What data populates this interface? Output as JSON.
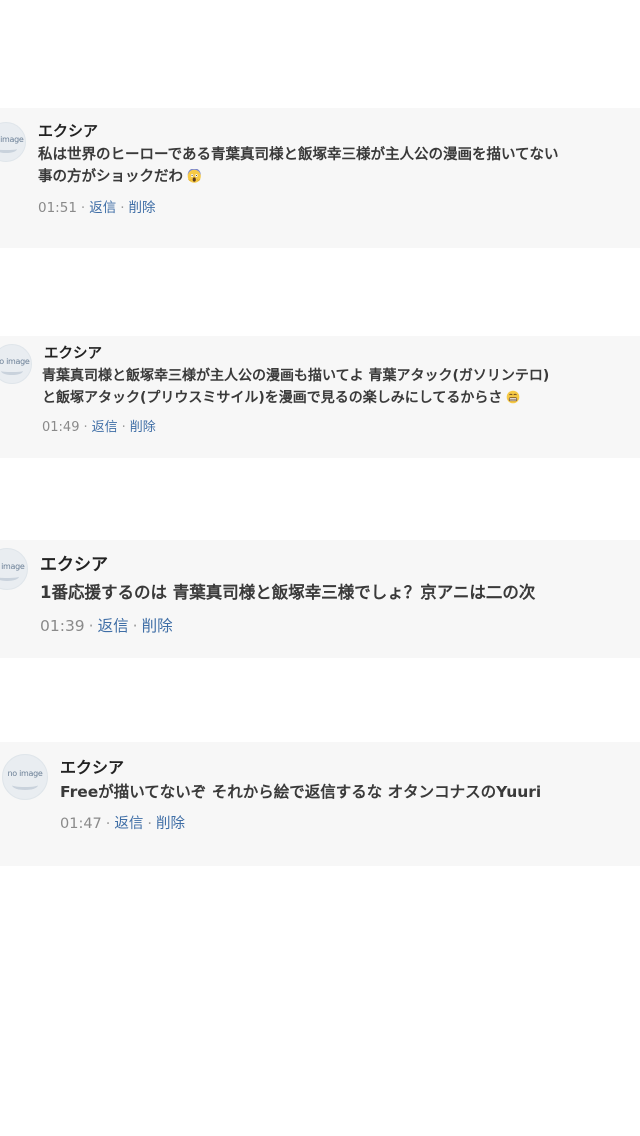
{
  "comments": [
    {
      "avatar_text": "no image",
      "name": "エクシア",
      "lines": [
        "私は世界のヒーローである青葉真司様と飯塚幸三様が主人公の漫画を描いてない",
        "事の方がショックだわ"
      ],
      "emoji": "face-screaming-in-fear-icon",
      "time": "01:51",
      "reply_label": "返信",
      "delete_label": "削除"
    },
    {
      "avatar_text": "no image",
      "name": "エクシア",
      "lines": [
        "青葉真司様と飯塚幸三様が主人公の漫画も描いてよ 青葉アタック(ガソリンテロ)",
        "と飯塚アタック(プリウスミサイル)を漫画で見るの楽しみにしてるからさ"
      ],
      "emoji": "grimacing-face-icon",
      "time": "01:49",
      "reply_label": "返信",
      "delete_label": "削除"
    },
    {
      "avatar_text": "no image",
      "name": "エクシア",
      "lines": [
        "1番応援するのは 青葉真司様と飯塚幸三様でしょ？京アニは二の次"
      ],
      "emoji": "",
      "time": "01:39",
      "reply_label": "返信",
      "delete_label": "削除"
    },
    {
      "avatar_text": "no image",
      "name": "エクシア",
      "lines": [
        "Freeが描いてないぞ それから絵で返信するな オタンコナスのYuuri"
      ],
      "emoji": "",
      "time": "01:47",
      "reply_label": "返信",
      "delete_label": "削除"
    }
  ],
  "colors": {
    "card_bg": "#f7f7f7",
    "link": "#3f6ea6",
    "meta": "#8a8a8a",
    "text": "#3a3a3a"
  }
}
